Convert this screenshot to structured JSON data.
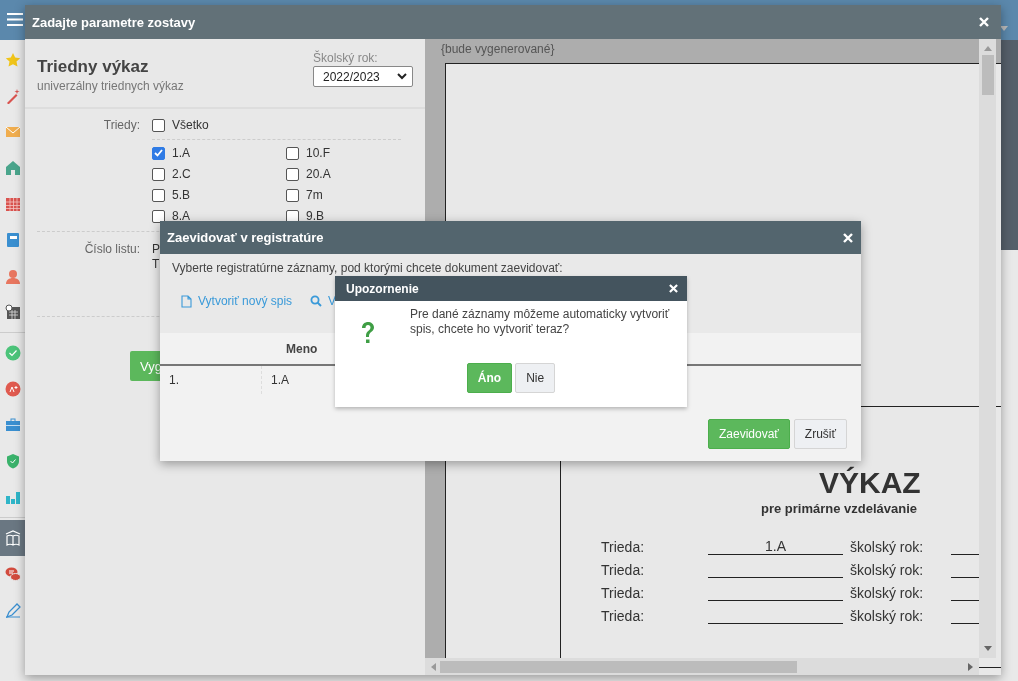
{
  "sidebar": {
    "items": [
      {
        "selected": false
      },
      {
        "selected": false
      },
      {
        "selected": false
      },
      {
        "selected": false
      },
      {
        "selected": false
      },
      {
        "selected": false
      },
      {
        "selected": false
      },
      {
        "selected": false
      },
      {
        "selected": false
      },
      {
        "selected": false
      },
      {
        "selected": false
      },
      {
        "selected": false
      },
      {
        "selected": false
      },
      {
        "selected": true
      },
      {
        "selected": false
      },
      {
        "selected": false
      }
    ]
  },
  "main_dialog": {
    "title": "Zadajte parametre zostavy"
  },
  "report": {
    "title": "Triedny výkaz",
    "subtitle": "univerzálny triednych výkaz"
  },
  "school_year": {
    "label": "Školský rok:",
    "value": "2022/2023"
  },
  "classes": {
    "label": "Triedy:",
    "all": {
      "label": "Všetko",
      "checked": false
    },
    "items": [
      {
        "label": "1.A",
        "checked": true
      },
      {
        "label": "10.F",
        "checked": false
      },
      {
        "label": "2.C",
        "checked": false
      },
      {
        "label": "20.A",
        "checked": false
      },
      {
        "label": "5.B",
        "checked": false
      },
      {
        "label": "7m",
        "checked": false
      },
      {
        "label": "8.A",
        "checked": false
      },
      {
        "label": "9.B",
        "checked": false
      }
    ]
  },
  "sheet_number": {
    "label": "Číslo listu:",
    "lines": [
      "P",
      "T"
    ]
  },
  "generate_button": "Vyg",
  "preview": {
    "placeholder_text": "{bude vygenerované}",
    "heading": "VÝKAZ",
    "subheading": "pre primárne vzdelávanie",
    "rows": [
      {
        "label": "Trieda:",
        "value": "1.A",
        "year_label": "školský rok:"
      },
      {
        "label": "Trieda:",
        "value": "",
        "year_label": "školský rok:"
      },
      {
        "label": "Trieda:",
        "value": "",
        "year_label": "školský rok:"
      },
      {
        "label": "Trieda:",
        "value": "",
        "year_label": "školský rok:"
      }
    ]
  },
  "registry_dialog": {
    "title": "Zaevidovať v registratúre",
    "instruction": "Vyberte registratúrne záznamy, pod ktorými chcete dokument zaevidovať:",
    "actions": [
      {
        "label": "Vytvoriť nový spis",
        "kind": "new"
      },
      {
        "label": "V",
        "kind": "search"
      }
    ],
    "columns": [
      "Meno"
    ],
    "rows": [
      {
        "number": "1.",
        "name": "1.A"
      }
    ],
    "buttons": [
      {
        "label": "Zaevidovať",
        "kind": "primary"
      },
      {
        "label": "Zrušiť",
        "kind": "default"
      }
    ]
  },
  "alert": {
    "title": "Upozornenie",
    "message": "Pre dané záznamy môžeme automaticky vytvoriť spis, chcete ho vytvoriť teraz?",
    "buttons": [
      {
        "label": "Áno",
        "kind": "primary"
      },
      {
        "label": "Nie",
        "kind": "default"
      }
    ]
  }
}
